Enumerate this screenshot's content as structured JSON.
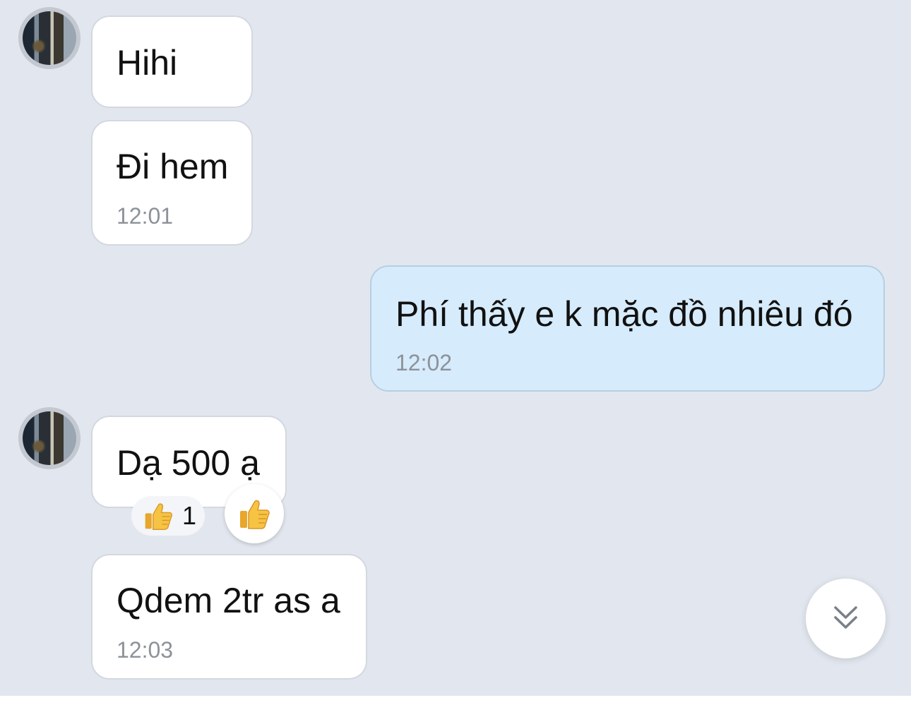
{
  "messages": [
    {
      "direction": "received",
      "text": "Hihi"
    },
    {
      "direction": "received",
      "text": "Đi hem",
      "time": "12:01"
    },
    {
      "direction": "sent",
      "text": "Phí thấy e k mặc đồ nhiêu đó",
      "time": "12:02"
    },
    {
      "direction": "received",
      "text": "Dạ 500 ạ",
      "reaction": {
        "emoji": "thumbs-up",
        "count": "1"
      }
    },
    {
      "direction": "received",
      "text": "Qdem 2tr as a",
      "time": "12:03"
    }
  ],
  "controls": {
    "react_button_icon": "thumbs-up-icon",
    "scroll_down_icon": "double-chevron-down-icon"
  },
  "colors": {
    "chat_background": "#e2e7ef",
    "received_bubble": "#ffffff",
    "sent_bubble": "#d6ebfb",
    "timestamp": "#8d9299",
    "reaction_yellow": "#f6c343"
  }
}
